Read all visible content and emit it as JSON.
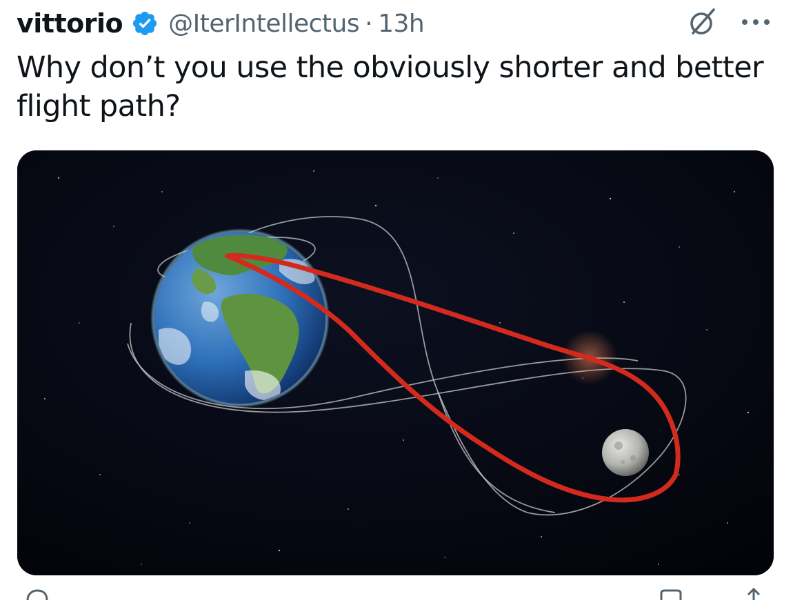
{
  "tweet": {
    "author": {
      "display_name": "vittorio",
      "verified_badge": "verified-badge-icon",
      "handle": "@IterIntellectus",
      "separator": "·",
      "time": "13h"
    },
    "text": "Why don’t you use the obviously shorter and better flight path?",
    "header_icons": [
      "grok-icon",
      "more-icon"
    ],
    "media": {
      "kind": "photo",
      "subject": "earth-moon-trajectory-illustration"
    }
  },
  "colors": {
    "text_primary": "#0f1419",
    "text_secondary": "#536471",
    "verified_blue": "#1d9bf0",
    "drawn_path_red": "#d42a1e",
    "space_background": "#05070f"
  }
}
